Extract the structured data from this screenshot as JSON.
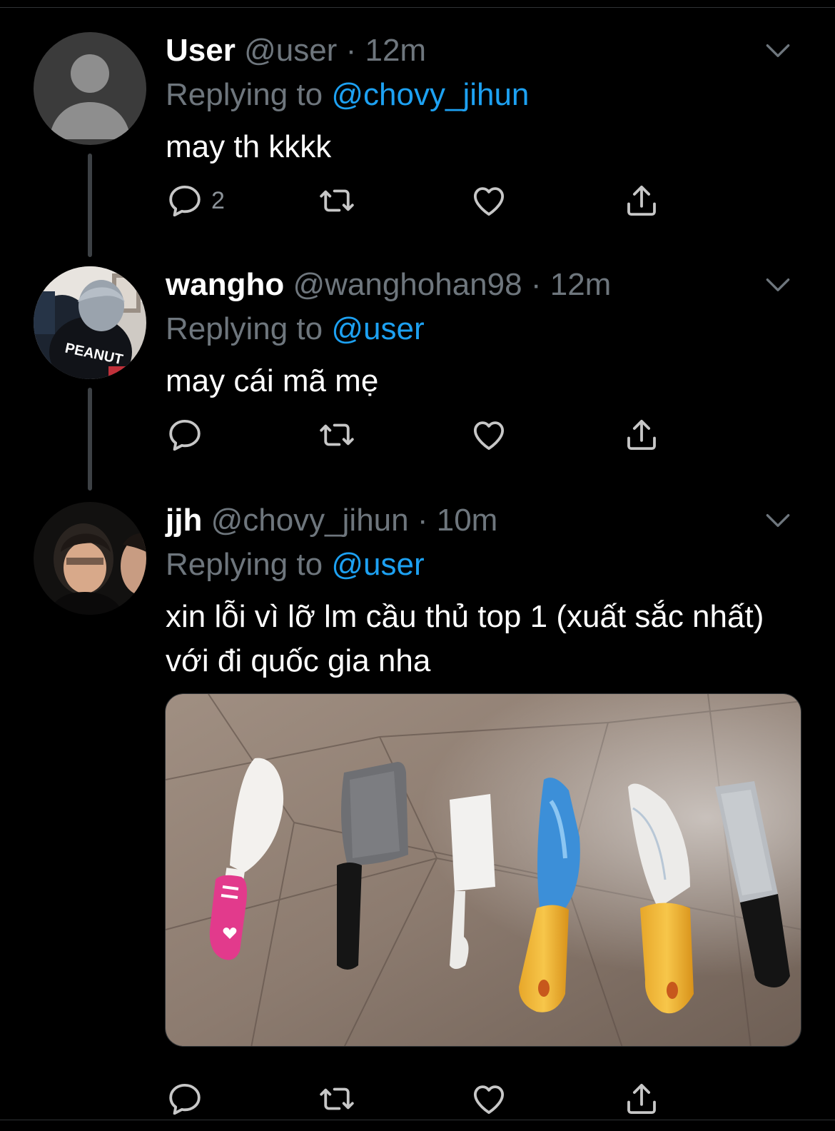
{
  "tweets": [
    {
      "name": "User",
      "handle": "@user",
      "sep": "·",
      "time": "12m",
      "replying_prefix": "Replying to ",
      "replying_to": "@chovy_jihun",
      "text": "may th kkkk",
      "reply_count": "2"
    },
    {
      "name": "wangho",
      "handle": "@wanghohan98",
      "sep": "·",
      "time": "12m",
      "replying_prefix": "Replying to ",
      "replying_to": "@user",
      "text": "may cái mã mẹ",
      "avatar_jersey_text": "PEANUT"
    },
    {
      "name": "jjh",
      "handle": "@chovy_jihun",
      "sep": "·",
      "time": "10m",
      "replying_prefix": "Replying to ",
      "replying_to": "@user",
      "text": "xin lỗi vì lỡ lm cầu thủ top 1 (xuất sắc nhất) với đi quốc gia nha"
    }
  ],
  "icons": {
    "more": "chevron-down-icon",
    "reply": "reply-icon",
    "retweet": "retweet-icon",
    "like": "heart-icon",
    "share": "share-icon"
  },
  "colors": {
    "background": "#000000",
    "text": "#ffffff",
    "muted": "#6e767d",
    "accent": "#1da1f2"
  }
}
